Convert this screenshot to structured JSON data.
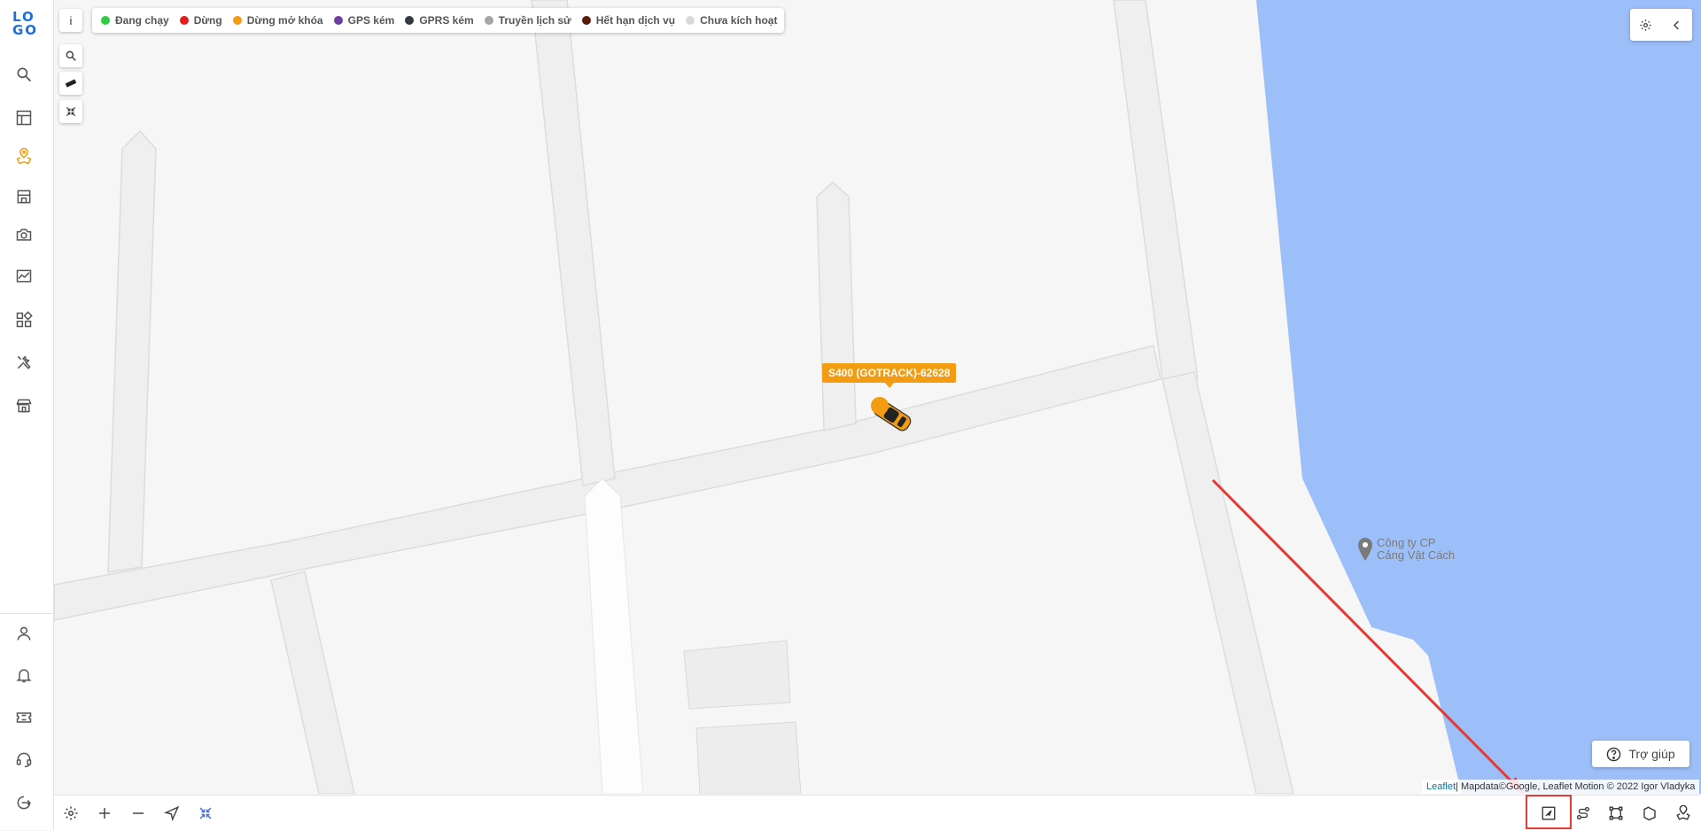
{
  "app": {
    "logo_line1": "LO",
    "logo_line2": "GO",
    "accent_color": "#f39c12",
    "brand_color": "#1e6fd9"
  },
  "sidebar": {
    "top_items": [
      {
        "icon": "search-icon"
      },
      {
        "icon": "dashboard-icon"
      },
      {
        "icon": "map-pin-icon",
        "active": true
      },
      {
        "icon": "store-icon"
      },
      {
        "icon": "camera-icon"
      },
      {
        "icon": "chart-icon"
      },
      {
        "icon": "apps-icon"
      },
      {
        "icon": "tools-icon"
      },
      {
        "icon": "shop-icon"
      }
    ],
    "bottom_items": [
      {
        "icon": "user-icon"
      },
      {
        "icon": "bell-icon"
      },
      {
        "icon": "ticket-icon"
      },
      {
        "icon": "headset-icon"
      },
      {
        "icon": "logout-icon"
      }
    ]
  },
  "legend": {
    "info_label": "i",
    "items": [
      {
        "label": "Đang chạy",
        "color": "#2ecc40"
      },
      {
        "label": "Dừng",
        "color": "#e21b1b"
      },
      {
        "label": "Dừng mở khóa",
        "color": "#f39c12"
      },
      {
        "label": "GPS kém",
        "color": "#6f3fa0"
      },
      {
        "label": "GPRS kém",
        "color": "#343a40"
      },
      {
        "label": "Truyền lịch sử",
        "color": "#a5a5a5"
      },
      {
        "label": "Hết hạn dịch vụ",
        "color": "#5c1a0a"
      },
      {
        "label": "Chưa kích hoạt",
        "color": "#d9d9d9"
      }
    ]
  },
  "map_tools": [
    "search-icon",
    "ruler-icon",
    "collapse-icon"
  ],
  "vehicle": {
    "label": "S400 (GOTRACK)-62628",
    "status_color": "#f39c12"
  },
  "poi": {
    "line1": "Công ty CP",
    "line2": "Cảng Vật Cách"
  },
  "help_button": {
    "label": "Trợ giúp"
  },
  "attribution": {
    "leaflet": "Leaflet",
    "text": " | Mapdata©Google, Leaflet Motion © 2022 Igor Vladyka"
  },
  "bottom_bar": {
    "left_tools": [
      "settings-icon",
      "zoom-in-icon",
      "zoom-out-icon",
      "locate-icon",
      "collapse-icon"
    ],
    "right_tools": [
      "map-select-icon",
      "route-icon",
      "area-icon",
      "zone-icon",
      "map-user-icon"
    ],
    "highlighted_tool": "map-select-icon"
  },
  "annotation_color": "#e53935",
  "water_color": "#9dbff9"
}
